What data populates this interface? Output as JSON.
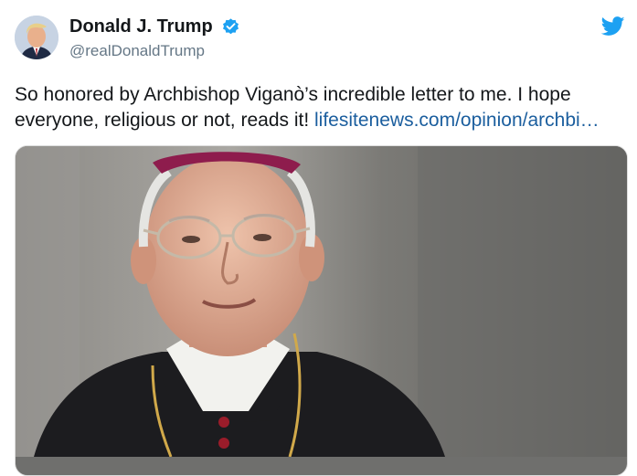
{
  "author": {
    "display_name": "Donald J. Trump",
    "handle": "@realDonaldTrump",
    "verified": true,
    "avatar_icon": "profile-photo"
  },
  "brand": {
    "icon": "twitter-bird-icon",
    "color": "#1da1f2"
  },
  "tweet": {
    "text": "So honored by Archbishop Viganò’s incredible letter to me. I hope everyone, religious or not, reads it! ",
    "link_text": "lifesitenews.com/opinion/archbi…",
    "link_color": "#1b5e9e"
  },
  "card": {
    "image_icon": "archbishop-photo"
  }
}
